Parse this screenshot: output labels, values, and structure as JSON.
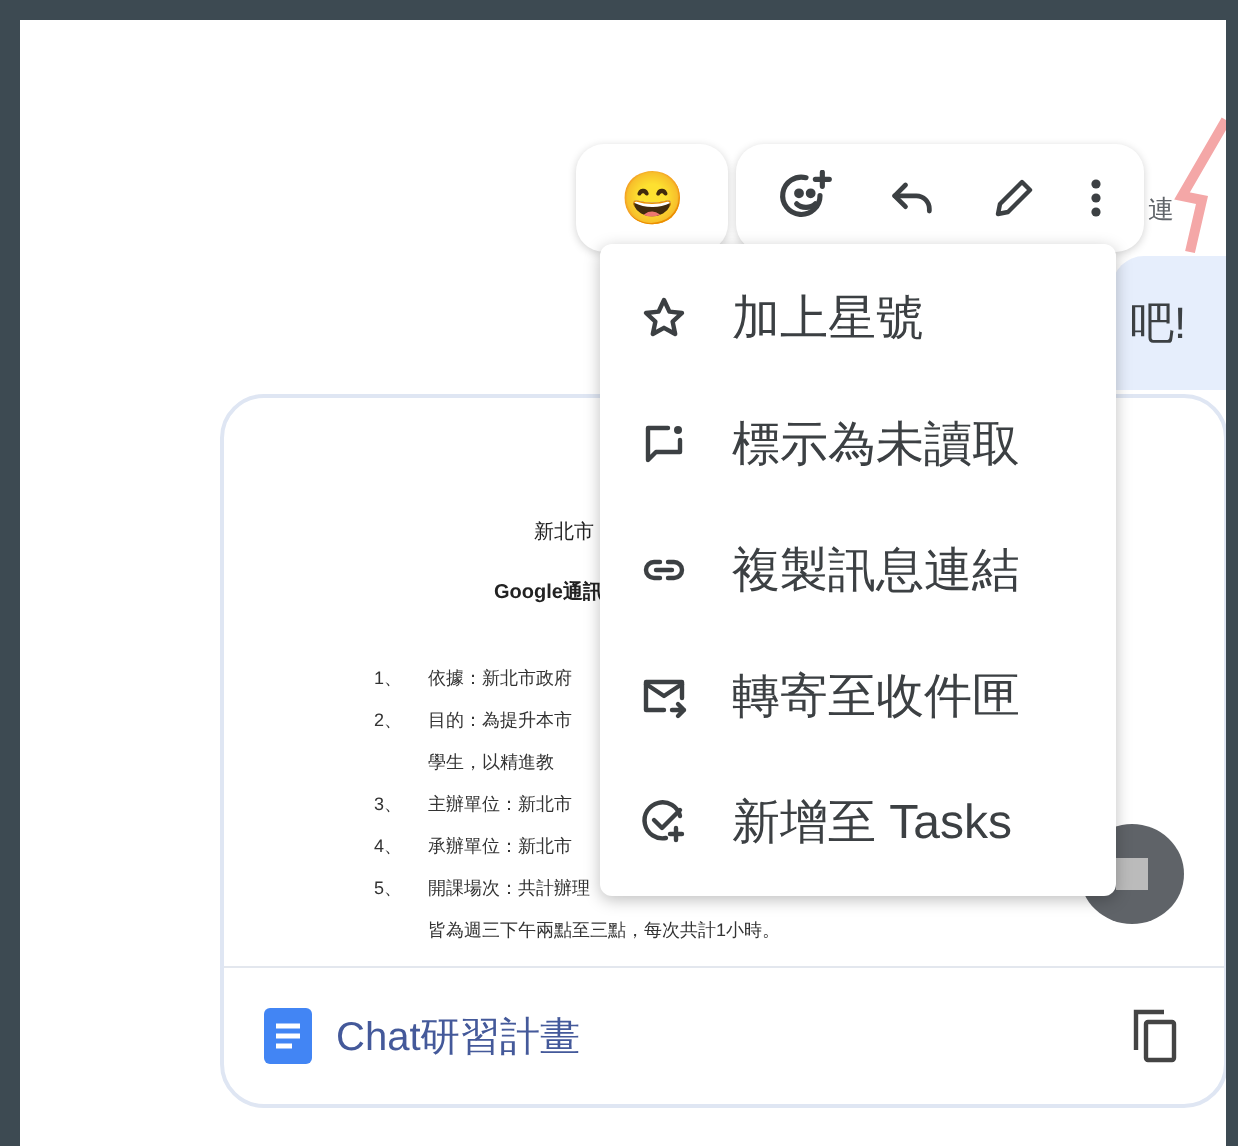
{
  "reaction": {
    "emoji": "😄"
  },
  "toolbar": {
    "actions": [
      {
        "kind": "add-reaction"
      },
      {
        "kind": "reply"
      },
      {
        "kind": "edit"
      },
      {
        "kind": "more"
      }
    ]
  },
  "sender_name": "連",
  "message": {
    "text": "吧!"
  },
  "attachment": {
    "document": {
      "title_lines": [
        "新北市",
        "Google通訊"
      ],
      "items": [
        {
          "number": "1、",
          "text": "依據：新北市政府"
        },
        {
          "number": "2、",
          "text": "目的：為提升本市"
        },
        {
          "text": "學生，以精進教"
        },
        {
          "number": "3、",
          "text": "主辦單位：新北市"
        },
        {
          "number": "4、",
          "text": "承辦單位：新北市"
        },
        {
          "number": "5、",
          "text": "開課場次：共計辦理"
        },
        {
          "text": "皆為週三下午兩點至三點，每次共計1小時。"
        }
      ]
    },
    "file_name": "Chat研習計畫"
  },
  "menu": {
    "items": [
      {
        "kind": "star",
        "label": "加上星號"
      },
      {
        "kind": "unread",
        "label": "標示為未讀取"
      },
      {
        "kind": "link",
        "label": "複製訊息連結"
      },
      {
        "kind": "forward",
        "label": "轉寄至收件匣"
      },
      {
        "kind": "tasks",
        "label": "新增至 Tasks"
      }
    ]
  }
}
